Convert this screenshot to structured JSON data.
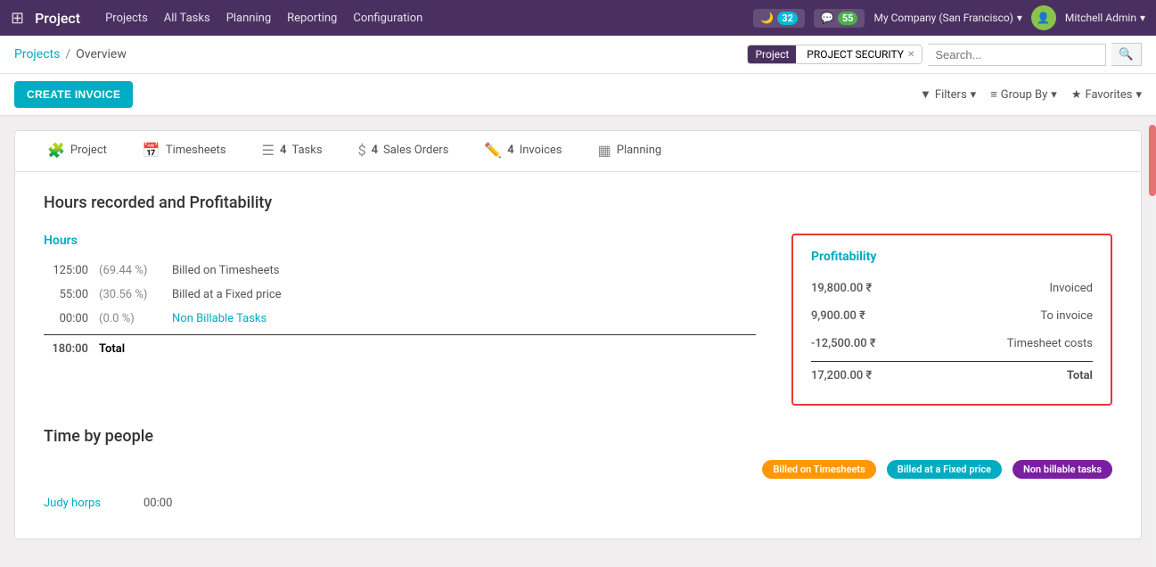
{
  "app": {
    "title": "Project",
    "grid_icon": "⊞"
  },
  "nav": {
    "links": [
      "Projects",
      "All Tasks",
      "Planning",
      "Reporting",
      "Configuration"
    ]
  },
  "header": {
    "notifications": {
      "moon_count": "32",
      "chat_count": "55"
    },
    "company": "My Company (San Francisco)",
    "user": "Mitchell Admin"
  },
  "breadcrumb": {
    "parent": "Projects",
    "separator": "/",
    "current": "Overview"
  },
  "search": {
    "filter_label": "Project",
    "filter_value": "PROJECT SECURITY",
    "placeholder": "Search..."
  },
  "toolbar": {
    "create_invoice_label": "CREATE INVOICE",
    "filters_label": "Filters",
    "group_by_label": "Group By",
    "favorites_label": "Favorites"
  },
  "tabs": [
    {
      "icon": "puzzle",
      "label": "Project",
      "count": null
    },
    {
      "icon": "calendar",
      "label": "Timesheets",
      "count": null
    },
    {
      "icon": "list",
      "label": "Tasks",
      "count": "4"
    },
    {
      "icon": "dollar",
      "label": "Sales Orders",
      "count": "4"
    },
    {
      "icon": "pencil",
      "label": "Invoices",
      "count": "4"
    },
    {
      "icon": "table",
      "label": "Planning",
      "count": null
    }
  ],
  "hours_section": {
    "title": "Hours recorded and Profitability",
    "hours_label": "Hours",
    "rows": [
      {
        "num": "125:00",
        "pct": "(69.44 %)",
        "label": "Billed on Timesheets",
        "link": false
      },
      {
        "num": "55:00",
        "pct": "(30.56 %)",
        "label": "Billed at a Fixed price",
        "link": false
      },
      {
        "num": "00:00",
        "pct": "(0.0 %)",
        "label": "Non Billable Tasks",
        "link": true
      }
    ],
    "total_num": "180:00",
    "total_label": "Total"
  },
  "profitability": {
    "label": "Profitability",
    "rows": [
      {
        "amount": "19,800.00 ₹",
        "label": "Invoiced"
      },
      {
        "amount": "9,900.00 ₹",
        "label": "To invoice"
      },
      {
        "amount": "-12,500.00 ₹",
        "label": "Timesheet costs"
      }
    ],
    "total_amount": "17,200.00 ₹",
    "total_label": "Total"
  },
  "time_by_people": {
    "title": "Time by people",
    "legend": [
      {
        "label": "Billed on Timesheets",
        "class": "timesheets"
      },
      {
        "label": "Billed at a Fixed price",
        "class": "fixed"
      },
      {
        "label": "Non billable tasks",
        "class": "nonbillable"
      }
    ],
    "rows": [
      {
        "name": "Judy horps",
        "hours": "00:00"
      }
    ]
  }
}
